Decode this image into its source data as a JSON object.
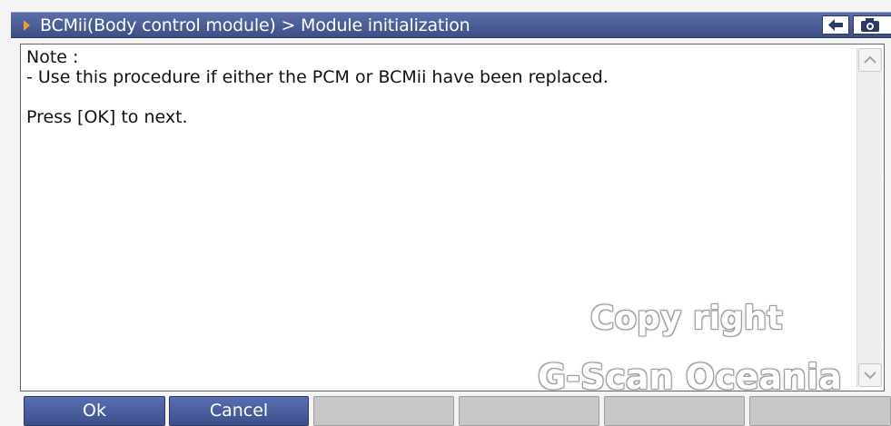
{
  "window": {
    "breadcrumb": "BCMii(Body control module) > Module initialization"
  },
  "content": {
    "lines": [
      "Note :",
      "- Use this procedure if either the PCM or BCMii have been replaced.",
      "",
      "Press [OK] to next."
    ]
  },
  "watermark": {
    "line1": "Copy right",
    "line2": "G-Scan Oceania"
  },
  "function_keys": [
    {
      "label": "Ok",
      "state": "enabled"
    },
    {
      "label": "Cancel",
      "state": "enabled"
    },
    {
      "label": "",
      "state": "disabled"
    },
    {
      "label": "",
      "state": "disabled"
    },
    {
      "label": "",
      "state": "disabled"
    },
    {
      "label": "",
      "state": "disabled"
    }
  ],
  "icons": {
    "title_marker": "right-triangle-icon",
    "back": "back-arrow-icon",
    "capture": "camera-icon",
    "scroll_up": "chevron-up-icon",
    "scroll_down": "chevron-down-icon"
  },
  "colors": {
    "title_bar": "#4a5c96",
    "title_marker": "#f39a2b",
    "button_active": "#4a5c96",
    "button_disabled": "#c8c8c8"
  }
}
